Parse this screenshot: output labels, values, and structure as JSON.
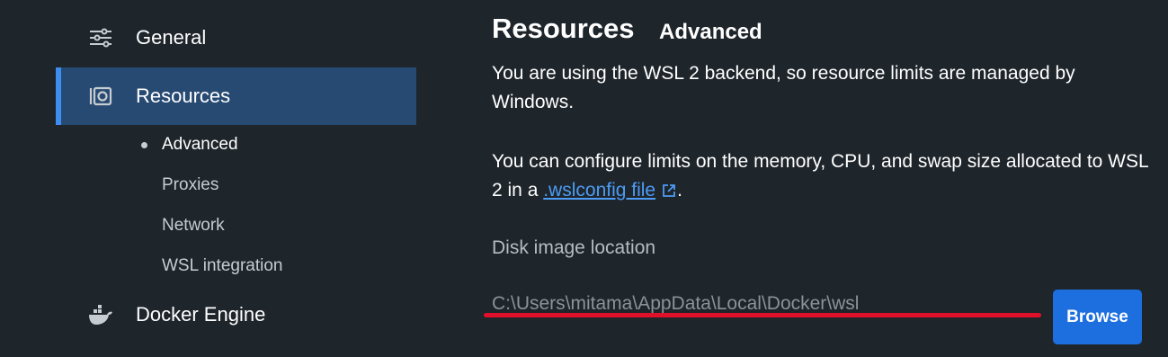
{
  "sidebar": {
    "general": {
      "label": "General",
      "icon": "sliders-icon"
    },
    "resources": {
      "label": "Resources",
      "icon": "resources-icon"
    },
    "subitems": [
      {
        "label": "Advanced",
        "active": true
      },
      {
        "label": "Proxies"
      },
      {
        "label": "Network"
      },
      {
        "label": "WSL integration"
      }
    ],
    "docker_engine": {
      "label": "Docker Engine",
      "icon": "whale-icon"
    }
  },
  "main": {
    "title": "Resources",
    "subtitle": "Advanced",
    "para1": "You are using the WSL 2 backend, so resource limits are managed by Windows.",
    "para2_prefix": "You can configure limits on the memory, CPU, and swap size allocated to WSL 2 in a ",
    "para2_link": ".wslconfig file",
    "para2_suffix": ".",
    "disk_label": "Disk image location",
    "disk_path": "C:\\Users\\mitama\\AppData\\Local\\Docker\\wsl",
    "browse_label": "Browse"
  },
  "colors": {
    "background": "#1e252b",
    "selected_bg": "#274a73",
    "accent": "#3d8ef0",
    "link": "#4d9cf5",
    "button": "#1d6fe0",
    "annotation_line": "#e0102a"
  }
}
